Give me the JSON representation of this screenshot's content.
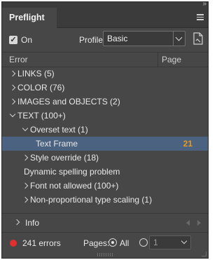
{
  "panel": {
    "title": "Preflight",
    "menu_icon": "hamburger-menu-icon",
    "collapse_icon": "double-chevron-icon"
  },
  "controls": {
    "on_checked": true,
    "on_label": "On",
    "profile_label": "Profile:",
    "profile_value": "Basic",
    "profile_icon": "define-profiles-icon"
  },
  "columns": {
    "error": "Error",
    "page": "Page"
  },
  "tree": [
    {
      "label": "LINKS (5)",
      "level": 0,
      "state": "collapsed",
      "page": ""
    },
    {
      "label": "COLOR (76)",
      "level": 0,
      "state": "collapsed",
      "page": ""
    },
    {
      "label": "IMAGES and OBJECTS (2)",
      "level": 0,
      "state": "collapsed",
      "page": ""
    },
    {
      "label": "TEXT (100+)",
      "level": 0,
      "state": "expanded",
      "page": ""
    },
    {
      "label": "Overset text (1)",
      "level": 1,
      "state": "expanded",
      "page": ""
    },
    {
      "label": "Text Frame",
      "level": 2,
      "state": "leaf",
      "page": "21",
      "selected": true
    },
    {
      "label": "Style override (18)",
      "level": 1,
      "state": "collapsed",
      "page": ""
    },
    {
      "label": "Dynamic spelling problem",
      "level": 1,
      "state": "leaf",
      "page": ""
    },
    {
      "label": "Font not allowed (100+)",
      "level": 1,
      "state": "collapsed",
      "page": ""
    },
    {
      "label": "Non-proportional type scaling (1)",
      "level": 1,
      "state": "collapsed",
      "page": ""
    }
  ],
  "info": {
    "label": "Info"
  },
  "footer": {
    "status_color": "#e2302f",
    "errors": "241 errors",
    "pages_label": "Pages:",
    "all_label": "All",
    "range_value": "1",
    "pages_mode": "all"
  },
  "colors": {
    "panel_bg": "#474747",
    "selected_row": "#4b6381",
    "page_number": "#e89a1d"
  }
}
